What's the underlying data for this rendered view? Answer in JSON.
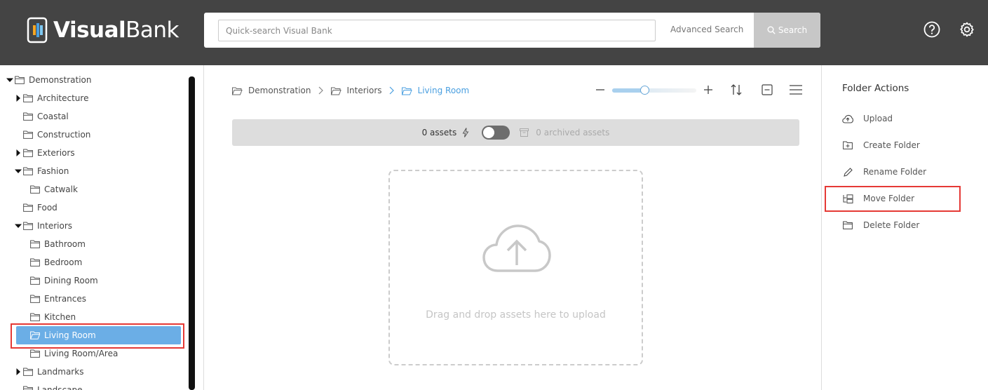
{
  "header": {
    "logo_visual": "Visual",
    "logo_bank": "Bank",
    "search_placeholder": "Quick-search Visual Bank",
    "advanced_search": "Advanced Search",
    "search_button": "Search",
    "bg_color": "#444444"
  },
  "tree": {
    "items": [
      {
        "label": "Demonstration",
        "caret": "down"
      },
      {
        "label": "Architecture",
        "caret": "right"
      },
      {
        "label": "Coastal",
        "caret": ""
      },
      {
        "label": "Construction",
        "caret": ""
      },
      {
        "label": "Exteriors",
        "caret": "right"
      },
      {
        "label": "Fashion",
        "caret": "down"
      },
      {
        "label": "Catwalk",
        "caret": ""
      },
      {
        "label": "Food",
        "caret": ""
      },
      {
        "label": "Interiors",
        "caret": "down"
      },
      {
        "label": "Bathroom",
        "caret": ""
      },
      {
        "label": "Bedroom",
        "caret": ""
      },
      {
        "label": "Dining Room",
        "caret": ""
      },
      {
        "label": "Entrances",
        "caret": ""
      },
      {
        "label": "Kitchen",
        "caret": ""
      },
      {
        "label": "Living Room",
        "caret": "",
        "selected": true
      },
      {
        "label": "Living Room/Area",
        "caret": ""
      },
      {
        "label": "Landmarks",
        "caret": "right"
      },
      {
        "label": "Landscape",
        "caret": ""
      }
    ]
  },
  "breadcrumb": {
    "items": [
      "Demonstration",
      "Interiors",
      "Living Room"
    ]
  },
  "zoom": {
    "level": 0.35
  },
  "status": {
    "assets": "0 assets",
    "archived": "0 archived assets"
  },
  "dropzone": {
    "text": "Drag and drop assets here to upload"
  },
  "actions": {
    "title": "Folder Actions",
    "items": [
      "Upload",
      "Create Folder",
      "Rename Folder",
      "Move Folder",
      "Delete Folder"
    ]
  },
  "colors": {
    "accent": "#4a9fe0",
    "selected": "#6baee6",
    "highlight": "#e53935"
  }
}
